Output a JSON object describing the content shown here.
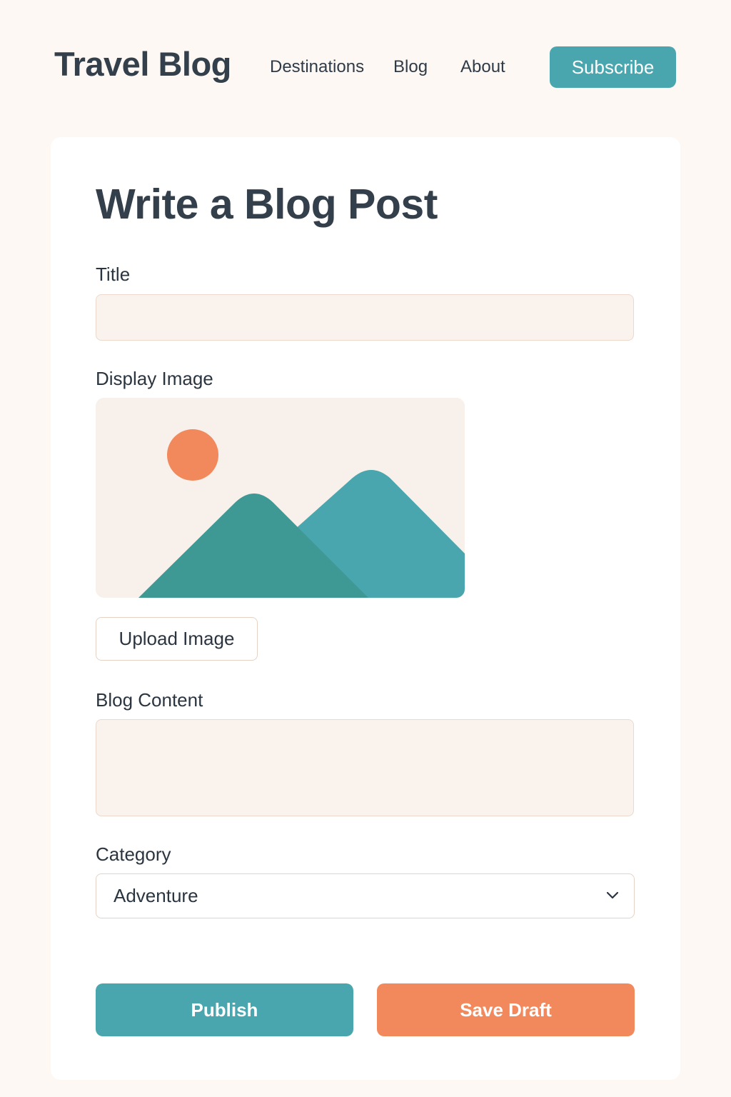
{
  "header": {
    "brand": "Travel Blog",
    "nav": [
      "Destinations",
      "Blog",
      "About"
    ],
    "subscribe_label": "Subscribe"
  },
  "form": {
    "heading": "Write a Blog Post",
    "title_label": "Title",
    "title_value": "",
    "image_label": "Display Image",
    "image_icon": "mountain-landscape-placeholder-icon",
    "upload_label": "Upload Image",
    "content_label": "Blog Content",
    "content_value": "",
    "category_label": "Category",
    "category_value": "Adventure",
    "category_icon": "chevron-down-icon"
  },
  "actions": {
    "publish_label": "Publish",
    "draft_label": "Save Draft"
  },
  "colors": {
    "accent_teal": "#4aa6ae",
    "accent_orange": "#f1895c",
    "page_background": "#fdf8f4",
    "input_background": "#faf2ec",
    "text_dark": "#333f4b"
  }
}
